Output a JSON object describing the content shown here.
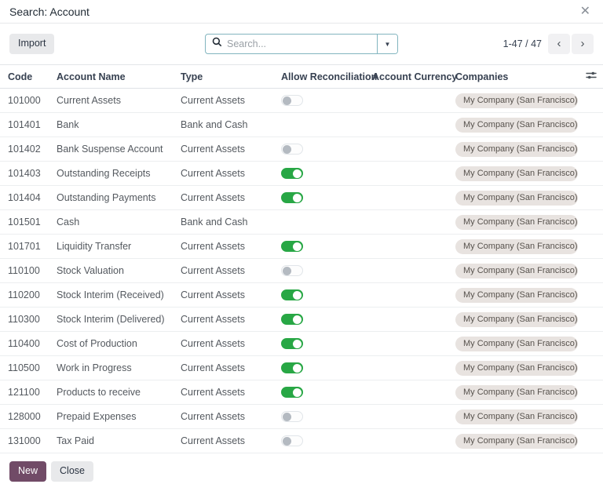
{
  "dialog": {
    "title": "Search: Account",
    "close_glyph": "✕"
  },
  "toolbar": {
    "import_label": "Import",
    "search": {
      "placeholder": "Search...",
      "icon": "magnifier-icon",
      "caret_glyph": "▼"
    },
    "pager": {
      "range": "1-47 / 47",
      "prev_glyph": "‹",
      "next_glyph": "›"
    }
  },
  "table": {
    "columns": [
      {
        "label": "Code"
      },
      {
        "label": "Account Name"
      },
      {
        "label": "Type"
      },
      {
        "label": "Allow Reconciliation"
      },
      {
        "label": "Account Currency"
      },
      {
        "label": "Companies"
      }
    ],
    "optional_columns_icon": "sliders-icon",
    "rows": [
      {
        "code": "101000",
        "name": "Current Assets",
        "type": "Current Assets",
        "reconcile": "off",
        "currency": "",
        "company": "My Company (San Francisco)"
      },
      {
        "code": "101401",
        "name": "Bank",
        "type": "Bank and Cash",
        "reconcile": "none",
        "currency": "",
        "company": "My Company (San Francisco)"
      },
      {
        "code": "101402",
        "name": "Bank Suspense Account",
        "type": "Current Assets",
        "reconcile": "off",
        "currency": "",
        "company": "My Company (San Francisco)"
      },
      {
        "code": "101403",
        "name": "Outstanding Receipts",
        "type": "Current Assets",
        "reconcile": "on",
        "currency": "",
        "company": "My Company (San Francisco)"
      },
      {
        "code": "101404",
        "name": "Outstanding Payments",
        "type": "Current Assets",
        "reconcile": "on",
        "currency": "",
        "company": "My Company (San Francisco)"
      },
      {
        "code": "101501",
        "name": "Cash",
        "type": "Bank and Cash",
        "reconcile": "none",
        "currency": "",
        "company": "My Company (San Francisco)"
      },
      {
        "code": "101701",
        "name": "Liquidity Transfer",
        "type": "Current Assets",
        "reconcile": "on",
        "currency": "",
        "company": "My Company (San Francisco)"
      },
      {
        "code": "110100",
        "name": "Stock Valuation",
        "type": "Current Assets",
        "reconcile": "off",
        "currency": "",
        "company": "My Company (San Francisco)"
      },
      {
        "code": "110200",
        "name": "Stock Interim (Received)",
        "type": "Current Assets",
        "reconcile": "on",
        "currency": "",
        "company": "My Company (San Francisco)"
      },
      {
        "code": "110300",
        "name": "Stock Interim (Delivered)",
        "type": "Current Assets",
        "reconcile": "on",
        "currency": "",
        "company": "My Company (San Francisco)"
      },
      {
        "code": "110400",
        "name": "Cost of Production",
        "type": "Current Assets",
        "reconcile": "on",
        "currency": "",
        "company": "My Company (San Francisco)"
      },
      {
        "code": "110500",
        "name": "Work in Progress",
        "type": "Current Assets",
        "reconcile": "on",
        "currency": "",
        "company": "My Company (San Francisco)"
      },
      {
        "code": "121100",
        "name": "Products to receive",
        "type": "Current Assets",
        "reconcile": "on",
        "currency": "",
        "company": "My Company (San Francisco)"
      },
      {
        "code": "128000",
        "name": "Prepaid Expenses",
        "type": "Current Assets",
        "reconcile": "off",
        "currency": "",
        "company": "My Company (San Francisco)"
      },
      {
        "code": "131000",
        "name": "Tax Paid",
        "type": "Current Assets",
        "reconcile": "off",
        "currency": "",
        "company": "My Company (San Francisco)"
      }
    ]
  },
  "footer": {
    "new_label": "New",
    "close_label": "Close"
  },
  "colors": {
    "accent": "#714B67",
    "toggle_on": "#28a745",
    "search_border": "#82b5bf",
    "badge_bg": "#e8e3e0"
  }
}
